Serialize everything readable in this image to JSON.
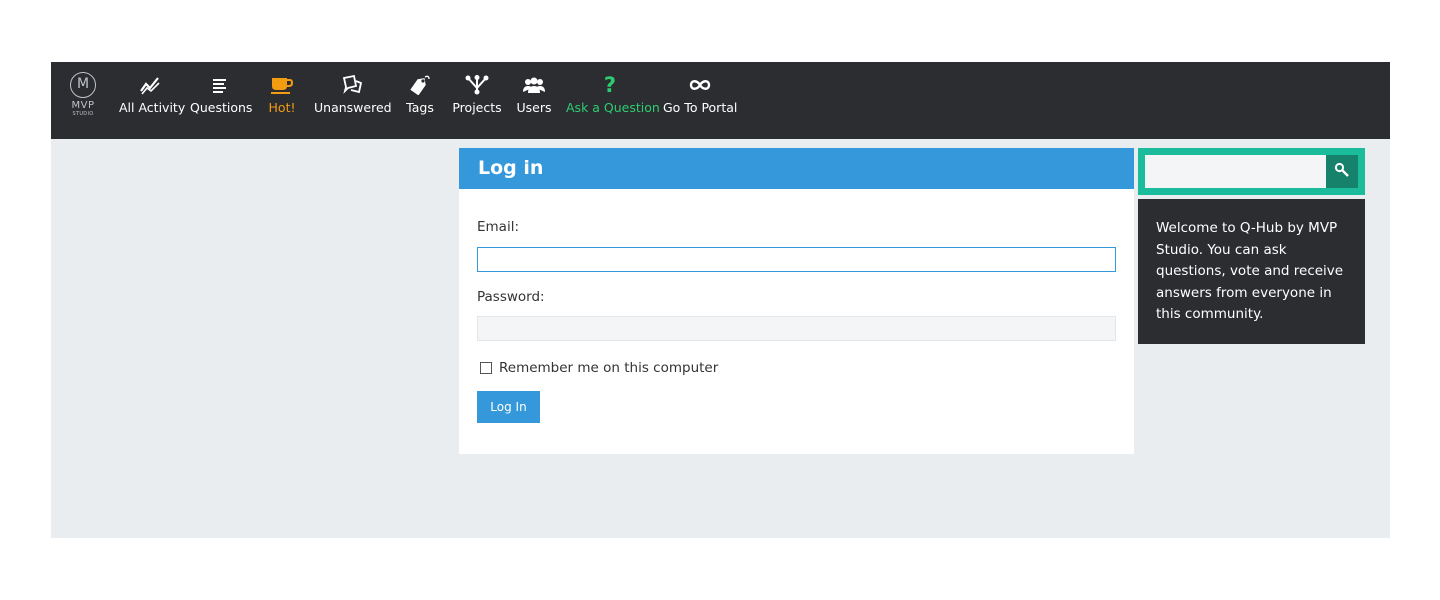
{
  "logo": {
    "title": "MVP",
    "subtitle": "STUDIO",
    "mark": "M"
  },
  "nav": {
    "items": [
      {
        "label": "All Activity",
        "icon": "activity-chart-icon"
      },
      {
        "label": "Questions",
        "icon": "list-lines-icon"
      },
      {
        "label": "Hot!",
        "icon": "coffee-cup-icon",
        "color": "#f39c12"
      },
      {
        "label": "Unanswered",
        "icon": "chat-bubbles-icon"
      },
      {
        "label": "Tags",
        "icon": "tag-icon"
      },
      {
        "label": "Projects",
        "icon": "fork-icon"
      },
      {
        "label": "Users",
        "icon": "users-icon"
      },
      {
        "label": "Ask a Question",
        "icon": "question-mark-icon",
        "color": "#2ecc71"
      },
      {
        "label": "Go To Portal",
        "icon": "infinity-icon"
      }
    ]
  },
  "login": {
    "title": "Log in",
    "email_label": "Email:",
    "email_value": "",
    "password_label": "Password:",
    "password_value": "",
    "remember_label": "Remember me on this computer",
    "remember_checked": false,
    "button_label": "Log In"
  },
  "search": {
    "value": "",
    "placeholder": "",
    "button_icon": "search-icon"
  },
  "welcome": {
    "text": "Welcome to Q-Hub by MVP Studio. You can ask questions, vote and receive answers from everyone in this community."
  },
  "colors": {
    "navbar": "#2b2d31",
    "accent_blue": "#3498db",
    "hot": "#f39c12",
    "ask": "#2ecc71",
    "search_frame": "#1abc9c",
    "search_button": "#16826b",
    "page_background": "#e9edef"
  }
}
